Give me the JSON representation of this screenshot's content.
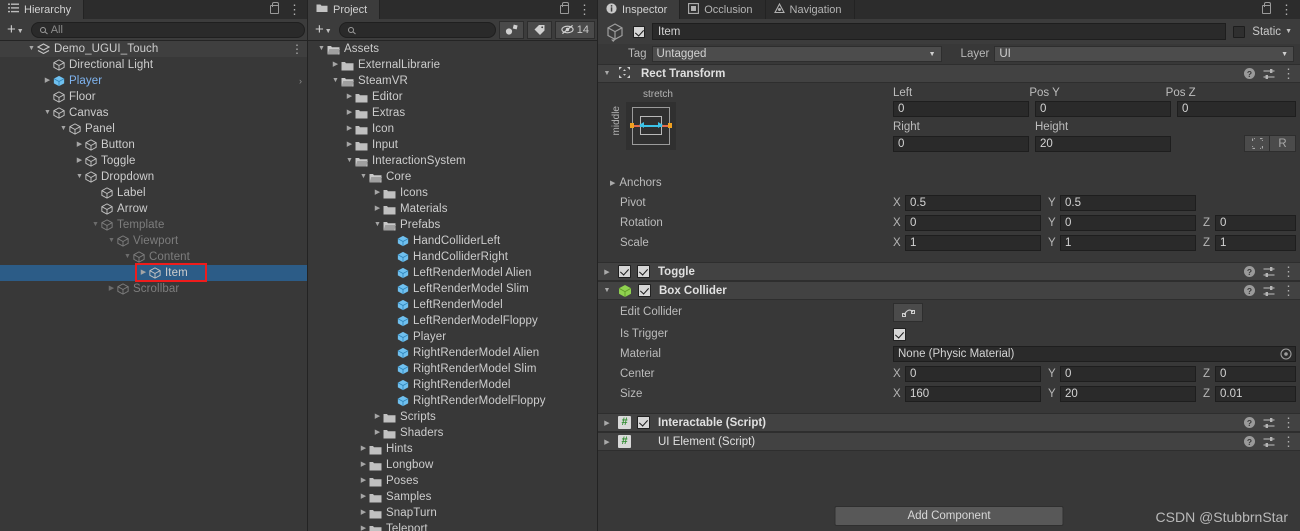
{
  "hierarchy": {
    "tab_label": "Hierarchy",
    "toolbar": {
      "add_label": "+",
      "search_placeholder": "All",
      "search_value": ""
    },
    "items": [
      {
        "label": "Demo_UGUI_Touch",
        "depth": 1,
        "arrow": "open",
        "icon": "scene-icon",
        "state": "normal",
        "alt": true,
        "kebab": true
      },
      {
        "label": "Directional Light",
        "depth": 2,
        "arrow": "none",
        "icon": "cube-icon",
        "state": "normal"
      },
      {
        "label": "Player",
        "depth": 2,
        "arrow": "closed",
        "icon": "prefab-cube-icon",
        "state": "prefab",
        "chevron": true
      },
      {
        "label": "Floor",
        "depth": 2,
        "arrow": "none",
        "icon": "cube-icon",
        "state": "normal"
      },
      {
        "label": "Canvas",
        "depth": 2,
        "arrow": "open",
        "icon": "cube-icon",
        "state": "normal"
      },
      {
        "label": "Panel",
        "depth": 3,
        "arrow": "open",
        "icon": "cube-icon",
        "state": "normal"
      },
      {
        "label": "Button",
        "depth": 4,
        "arrow": "closed",
        "icon": "cube-icon",
        "state": "normal"
      },
      {
        "label": "Toggle",
        "depth": 4,
        "arrow": "closed",
        "icon": "cube-icon",
        "state": "normal"
      },
      {
        "label": "Dropdown",
        "depth": 4,
        "arrow": "open",
        "icon": "cube-icon",
        "state": "normal"
      },
      {
        "label": "Label",
        "depth": 5,
        "arrow": "none",
        "icon": "cube-icon",
        "state": "normal"
      },
      {
        "label": "Arrow",
        "depth": 5,
        "arrow": "none",
        "icon": "cube-icon",
        "state": "normal"
      },
      {
        "label": "Template",
        "depth": 5,
        "arrow": "open",
        "icon": "cube-icon",
        "state": "disabled"
      },
      {
        "label": "Viewport",
        "depth": 6,
        "arrow": "open",
        "icon": "cube-icon",
        "state": "disabled"
      },
      {
        "label": "Content",
        "depth": 7,
        "arrow": "open",
        "icon": "cube-icon",
        "state": "disabled"
      },
      {
        "label": "Item",
        "depth": 8,
        "arrow": "closed",
        "icon": "cube-icon",
        "state": "selected",
        "annotated": true
      },
      {
        "label": "Scrollbar",
        "depth": 6,
        "arrow": "closed",
        "icon": "cube-icon",
        "state": "disabled"
      }
    ]
  },
  "project": {
    "tab_label": "Project",
    "toolbar": {
      "add_label": "+",
      "search_placeholder": "",
      "hidden_count": "14"
    },
    "items": [
      {
        "label": "Assets",
        "depth": 0,
        "arrow": "open",
        "icon": "folder-open-icon"
      },
      {
        "label": "ExternalLibrarie",
        "depth": 1,
        "arrow": "closed",
        "icon": "folder-icon"
      },
      {
        "label": "SteamVR",
        "depth": 1,
        "arrow": "open",
        "icon": "folder-open-icon"
      },
      {
        "label": "Editor",
        "depth": 2,
        "arrow": "closed",
        "icon": "folder-icon"
      },
      {
        "label": "Extras",
        "depth": 2,
        "arrow": "closed",
        "icon": "folder-icon"
      },
      {
        "label": "Icon",
        "depth": 2,
        "arrow": "closed",
        "icon": "folder-icon"
      },
      {
        "label": "Input",
        "depth": 2,
        "arrow": "closed",
        "icon": "folder-icon"
      },
      {
        "label": "InteractionSystem",
        "depth": 2,
        "arrow": "open",
        "icon": "folder-open-icon"
      },
      {
        "label": "Core",
        "depth": 3,
        "arrow": "open",
        "icon": "folder-open-icon"
      },
      {
        "label": "Icons",
        "depth": 4,
        "arrow": "closed",
        "icon": "folder-icon"
      },
      {
        "label": "Materials",
        "depth": 4,
        "arrow": "closed",
        "icon": "folder-icon"
      },
      {
        "label": "Prefabs",
        "depth": 4,
        "arrow": "open",
        "icon": "folder-open-icon"
      },
      {
        "label": "HandColliderLeft",
        "depth": 5,
        "arrow": "none",
        "icon": "prefab-cube-icon"
      },
      {
        "label": "HandColliderRight",
        "depth": 5,
        "arrow": "none",
        "icon": "prefab-cube-icon"
      },
      {
        "label": "LeftRenderModel Alien",
        "depth": 5,
        "arrow": "none",
        "icon": "prefab-cube-icon"
      },
      {
        "label": "LeftRenderModel Slim",
        "depth": 5,
        "arrow": "none",
        "icon": "prefab-cube-icon"
      },
      {
        "label": "LeftRenderModel",
        "depth": 5,
        "arrow": "none",
        "icon": "prefab-cube-icon"
      },
      {
        "label": "LeftRenderModelFloppy",
        "depth": 5,
        "arrow": "none",
        "icon": "prefab-cube-icon"
      },
      {
        "label": "Player",
        "depth": 5,
        "arrow": "none",
        "icon": "prefab-cube-icon"
      },
      {
        "label": "RightRenderModel Alien",
        "depth": 5,
        "arrow": "none",
        "icon": "prefab-cube-icon"
      },
      {
        "label": "RightRenderModel Slim",
        "depth": 5,
        "arrow": "none",
        "icon": "prefab-cube-icon"
      },
      {
        "label": "RightRenderModel",
        "depth": 5,
        "arrow": "none",
        "icon": "prefab-cube-icon"
      },
      {
        "label": "RightRenderModelFloppy",
        "depth": 5,
        "arrow": "none",
        "icon": "prefab-cube-icon"
      },
      {
        "label": "Scripts",
        "depth": 4,
        "arrow": "closed",
        "icon": "folder-icon"
      },
      {
        "label": "Shaders",
        "depth": 4,
        "arrow": "closed",
        "icon": "folder-icon"
      },
      {
        "label": "Hints",
        "depth": 3,
        "arrow": "closed",
        "icon": "folder-icon"
      },
      {
        "label": "Longbow",
        "depth": 3,
        "arrow": "closed",
        "icon": "folder-icon"
      },
      {
        "label": "Poses",
        "depth": 3,
        "arrow": "closed",
        "icon": "folder-icon"
      },
      {
        "label": "Samples",
        "depth": 3,
        "arrow": "closed",
        "icon": "folder-icon"
      },
      {
        "label": "SnapTurn",
        "depth": 3,
        "arrow": "closed",
        "icon": "folder-icon"
      },
      {
        "label": "Teleport",
        "depth": 3,
        "arrow": "closed",
        "icon": "folder-icon"
      }
    ]
  },
  "inspector": {
    "tabs": [
      {
        "label": "Inspector",
        "icon": "info-icon",
        "active": true
      },
      {
        "label": "Occlusion",
        "icon": "occlusion-icon",
        "active": false
      },
      {
        "label": "Navigation",
        "icon": "navigation-icon",
        "active": false
      }
    ],
    "object": {
      "enabled": true,
      "name_value": "Item",
      "static_label": "Static",
      "static_checked": false,
      "tag_label": "Tag",
      "tag_value": "Untagged",
      "layer_label": "Layer",
      "layer_value": "UI"
    },
    "rect_transform": {
      "title": "Rect Transform",
      "anchor_preset_top": "stretch",
      "anchor_preset_side": "middle",
      "fields": {
        "left_label": "Left",
        "left_value": "0",
        "pos_y_label": "Pos Y",
        "pos_y_value": "0",
        "pos_z_label": "Pos Z",
        "pos_z_value": "0",
        "right_label": "Right",
        "right_value": "0",
        "height_label": "Height",
        "height_value": "20",
        "anchors_label": "Anchors",
        "pivot_label": "Pivot",
        "pivot_x": "0.5",
        "pivot_y": "0.5",
        "rotation_label": "Rotation",
        "rotation_x": "0",
        "rotation_y": "0",
        "rotation_z": "0",
        "scale_label": "Scale",
        "scale_x": "1",
        "scale_y": "1",
        "scale_z": "1"
      },
      "blueprint_label": "",
      "rawedit_label": "R"
    },
    "toggle_component": {
      "title": "Toggle",
      "enabled": true,
      "collapsed": true
    },
    "box_collider": {
      "title": "Box Collider",
      "enabled": true,
      "edit_collider_label": "Edit Collider",
      "is_trigger_label": "Is Trigger",
      "is_trigger_checked": true,
      "material_label": "Material",
      "material_value": "None (Physic Material)",
      "center_label": "Center",
      "center_x": "0",
      "center_y": "0",
      "center_z": "0",
      "size_label": "Size",
      "size_x": "160",
      "size_y": "20",
      "size_z": "0.01"
    },
    "scripts": [
      {
        "title": "Interactable (Script)",
        "has_checkbox": true,
        "checked": true
      },
      {
        "title": "UI Element (Script)",
        "has_checkbox": false,
        "checked": false
      }
    ],
    "add_component_label": "Add Component"
  },
  "watermark": "CSDN @StubbrnStar",
  "colors": {
    "panel_bg": "#383838",
    "header_bg": "#424242",
    "selection_blue": "#2c5c87",
    "annotation_red": "#ef1c1c",
    "prefab_blue": "#7fb4f0",
    "collider_green": "#8fd14f"
  }
}
